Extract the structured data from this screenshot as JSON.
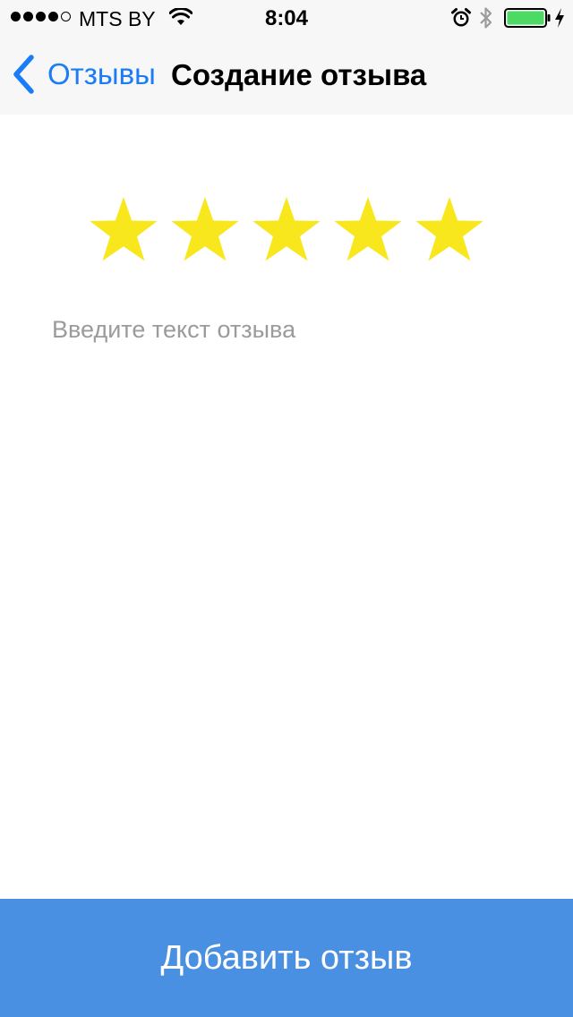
{
  "status_bar": {
    "signal": {
      "filled": 4,
      "total": 5
    },
    "carrier": "MTS BY",
    "time": "8:04",
    "battery_level": 1.0,
    "charging": true
  },
  "nav": {
    "back_label": "Отзывы",
    "title": "Создание отзыва"
  },
  "rating": {
    "value": 5,
    "max": 5,
    "star_color": "#f8e71c"
  },
  "review": {
    "placeholder": "Введите текст отзыва",
    "value": ""
  },
  "submit": {
    "label": "Добавить отзыв",
    "color": "#4a90e2"
  },
  "colors": {
    "accent": "#1a7cf6",
    "battery": "#4cd964"
  },
  "icons": {
    "wifi": "wifi-icon",
    "alarm": "alarm-icon",
    "bluetooth": "bluetooth-icon",
    "battery": "battery-icon",
    "charging": "charging-bolt-icon",
    "back": "chevron-left-icon",
    "star": "star-icon"
  }
}
